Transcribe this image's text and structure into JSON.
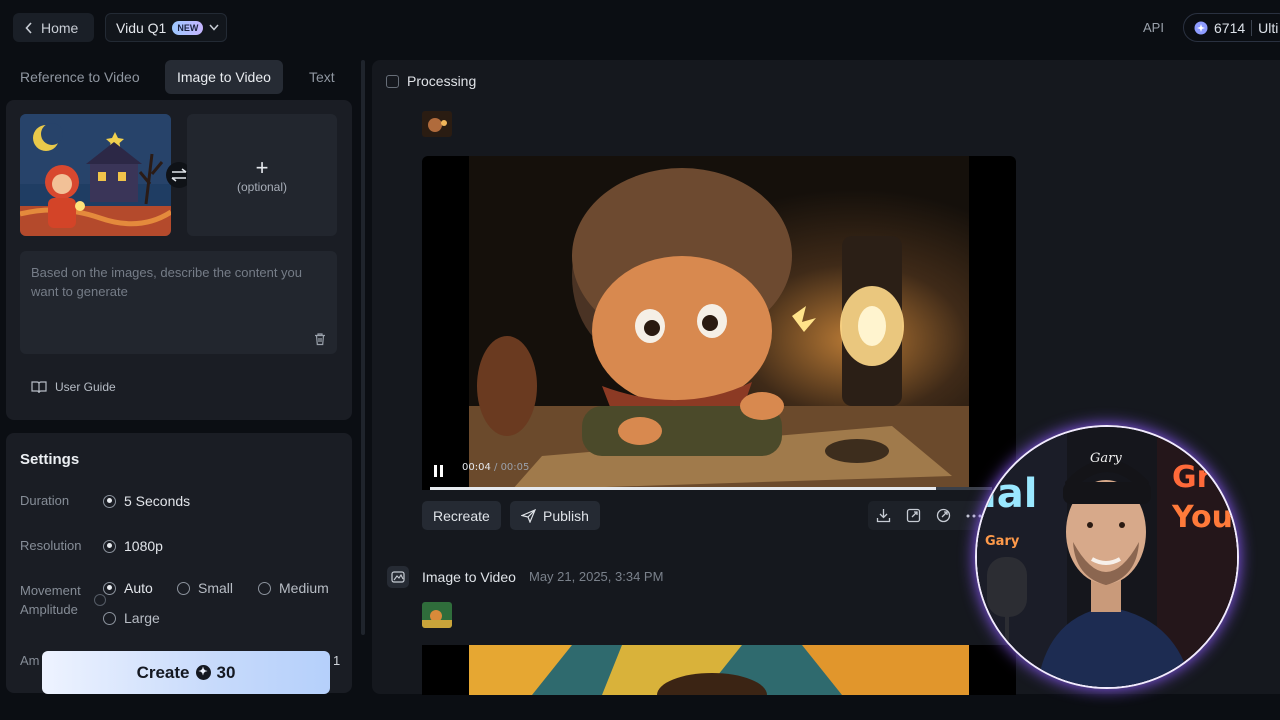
{
  "topbar": {
    "home_label": "Home",
    "model_label": "Vidu Q1",
    "model_badge": "NEW",
    "api_label": "API",
    "credits": "6714",
    "plan_label": "Ulti"
  },
  "tabs": [
    {
      "label": "Reference to Video",
      "active": false
    },
    {
      "label": "Image to Video",
      "active": true
    },
    {
      "label": "Text to Video",
      "active": false
    }
  ],
  "input": {
    "optional_label": "(optional)",
    "prompt_placeholder": "Based on the images, describe the content you want to generate",
    "user_guide": "User Guide"
  },
  "settings": {
    "title": "Settings",
    "duration_label": "Duration",
    "duration_value": "5 Seconds",
    "resolution_label": "Resolution",
    "resolution_value": "1080p",
    "movement_label": "Movement Amplitude",
    "movement_options": [
      {
        "label": "Auto",
        "selected": true
      },
      {
        "label": "Small",
        "selected": false
      },
      {
        "label": "Medium",
        "selected": false
      },
      {
        "label": "Large",
        "selected": false
      }
    ],
    "cutoff_label": "Am",
    "cutoff_value": "1"
  },
  "create": {
    "label": "Create",
    "cost": "30"
  },
  "result": {
    "status_label": "Processing",
    "time_current": "00:04",
    "time_total": "00:05",
    "progress_fraction": 0.9,
    "recreate_label": "Recreate",
    "publish_label": "Publish"
  },
  "history": {
    "title": "Image to Video",
    "date": "May 21, 2025, 3:34 PM"
  },
  "webcam": {
    "cap_text": "Gary",
    "neon_left": "ial",
    "neon_sub": "Gary",
    "neon_right_1": "Gr",
    "neon_right_2": "You"
  },
  "colors": {
    "accent": "#b5d0fb",
    "panel": "#1a1d24",
    "background": "#0b0e13"
  }
}
